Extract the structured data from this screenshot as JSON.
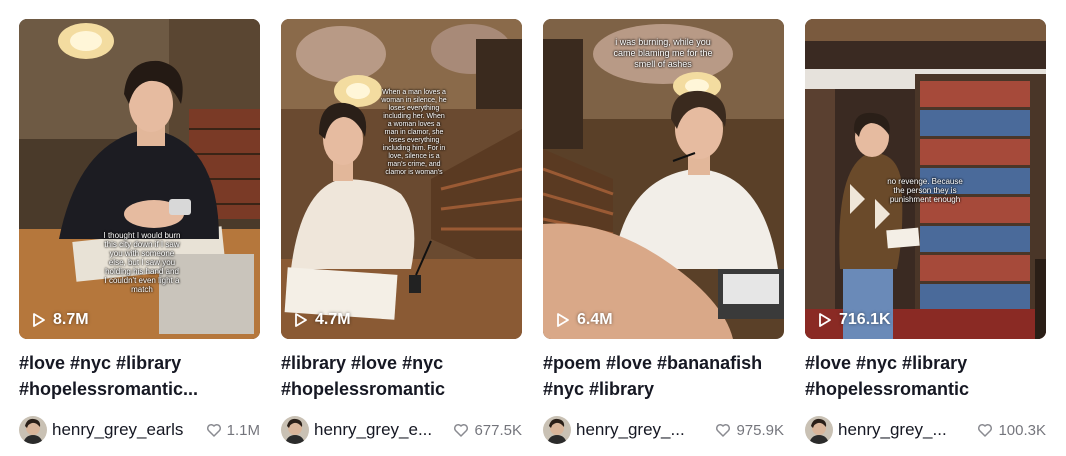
{
  "videos": [
    {
      "caption": "I thought I would burn this city down if I saw you with someone else, but I saw you holding his hand and I couldn't even light a match",
      "views": "8.7M",
      "description": "#love #nyc #library #hopelessromantic...",
      "author": "henry_grey_earls",
      "likes": "1.1M"
    },
    {
      "caption": "When a man loves a woman in silence, he loses everything including her. When a woman loves a man in clamor, she loses everything including him. For in love, silence is a man's crime, and clamor is woman's",
      "views": "4.7M",
      "description": "#library #love #nyc #hopelessromantic",
      "author": "henry_grey_e...",
      "likes": "677.5K"
    },
    {
      "caption": "i was burning, while you came blaming me for the smell of ashes",
      "views": "6.4M",
      "description": "#poem #love #bananafish #nyc #library",
      "author": "henry_grey_...",
      "likes": "975.9K"
    },
    {
      "caption": "no revenge. Because the person they is punishment enough",
      "views": "716.1K",
      "description": "#love #nyc #library #hopelessromantic",
      "author": "henry_grey_...",
      "likes": "100.3K"
    }
  ],
  "icons": {
    "views": "play-outline-icon",
    "likes": "heart-outline-icon"
  },
  "colors": {
    "text": "#161823",
    "muted": "#8a8b91",
    "overlay_text": "#ffffff"
  }
}
